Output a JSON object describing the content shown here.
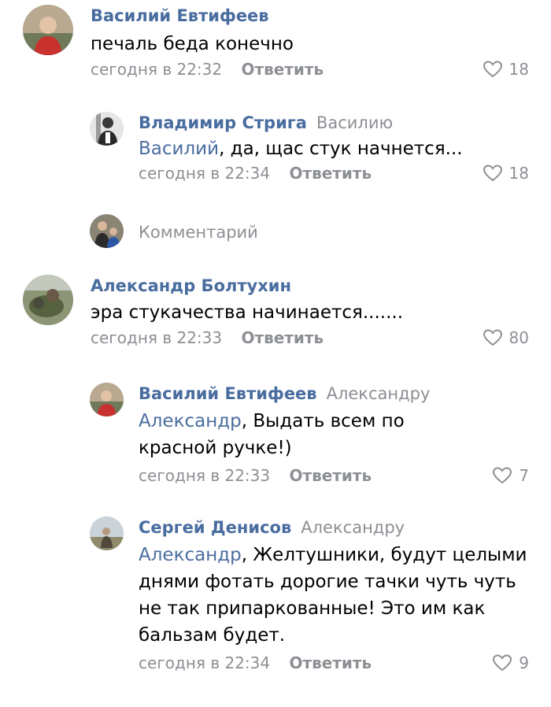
{
  "comments": [
    {
      "author": "Василий Евтифеев",
      "text": "печаль беда конечно",
      "time": "сегодня в 22:32",
      "reply_label": "Ответить",
      "likes": "18"
    },
    {
      "author": "Владимир Стрига",
      "addressee": "Василию",
      "mention": "Василий",
      "text": ", да, щас стук начнется...",
      "time": "сегодня в 22:34",
      "reply_label": "Ответить",
      "likes": "18"
    },
    {
      "author": "Александр Болтухин",
      "text": "эра стукачества начинается.......",
      "time": "сегодня в 22:33",
      "reply_label": "Ответить",
      "likes": "80"
    },
    {
      "author": "Василий Евтифеев",
      "addressee": "Александру",
      "mention": "Александр",
      "text": ", Выдать всем по красной ручке!)",
      "time": "сегодня в 22:33",
      "reply_label": "Ответить",
      "likes": "7"
    },
    {
      "author": "Сергей Денисов",
      "addressee": "Александру",
      "mention": "Александр",
      "text": ", Желтушники, будут целыми днями фотать дорогие тачки чуть чуть не так припаркованные! Это им как бальзам будет.",
      "time": "сегодня в 22:34",
      "reply_label": "Ответить",
      "likes": "9"
    }
  ],
  "write_comment": {
    "placeholder": "Комментарий"
  },
  "colors": {
    "link": "#4a6da0",
    "muted": "#8c8f94",
    "text": "#000000"
  },
  "icons": {
    "like": "heart-icon"
  }
}
